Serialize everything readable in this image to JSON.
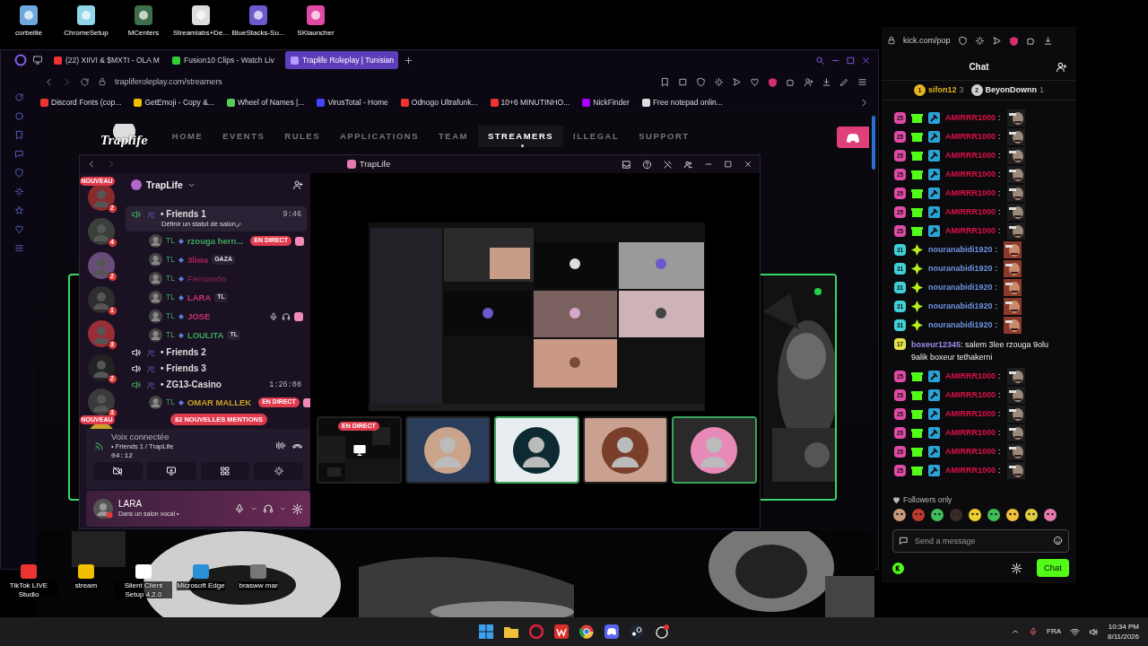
{
  "desktop_top": [
    {
      "label": "corbeille"
    },
    {
      "label": "ChromeSetup"
    },
    {
      "label": "MCenters"
    },
    {
      "label": "Streamlabs+De..."
    },
    {
      "label": "BlueStacks-Su..."
    },
    {
      "label": "SKlauncher"
    }
  ],
  "browser": {
    "tabs": [
      {
        "label": "(22) XIIVI & $MXTI - OLA M",
        "selected": false
      },
      {
        "label": "Fusion10 Clips - Watch Liv",
        "selected": false
      },
      {
        "label": "Traplife Roleplay | Tunisian",
        "selected": true
      }
    ],
    "url": "trapliferoleplay.com/streamers",
    "bookmarks": [
      {
        "label": "Discord Fonts (cop..."
      },
      {
        "label": "GetEmoji - Copy &..."
      },
      {
        "label": "Wheel of Names |..."
      },
      {
        "label": "VirusTotal - Home"
      },
      {
        "label": "Odnogo Ultrafunk..."
      },
      {
        "label": "10+6 MINUTINHO..."
      },
      {
        "label": "NickFinder"
      },
      {
        "label": "Free notepad onlin..."
      }
    ]
  },
  "site": {
    "logo": "Traplife",
    "nav": [
      {
        "label": "HOME",
        "selected": false
      },
      {
        "label": "EVENTS",
        "selected": false
      },
      {
        "label": "RULES",
        "selected": false
      },
      {
        "label": "APPLICATIONS",
        "selected": false
      },
      {
        "label": "TEAM",
        "selected": false
      },
      {
        "label": "STREAMERS",
        "selected": true
      },
      {
        "label": "ILLEGAL",
        "selected": false
      },
      {
        "label": "SUPPORT",
        "selected": false
      }
    ]
  },
  "discord": {
    "title": "TrapLife",
    "server": "TrapLife",
    "servers": [
      {
        "count": "2",
        "new_label": "NOUVEAU"
      },
      {
        "count": "4"
      },
      {
        "count": "2"
      },
      {
        "count": "1"
      },
      {
        "count": "3"
      },
      {
        "count": "2"
      },
      {
        "count": "3"
      },
      {
        "new_label": "NOUVEAU"
      }
    ],
    "channels": [
      {
        "name": "• Friends 1",
        "selected": true,
        "time": "9:46",
        "status": "Définir un statut de salon",
        "members": [
          {
            "tag": "TL",
            "name": "rzouga hern...",
            "color": "#3ba55c",
            "live_label": "EN DIRECT",
            "muted": false
          },
          {
            "tag": "TL",
            "name": "3liwa",
            "color": "#a8245c",
            "badge": "GAZA",
            "muted": false
          },
          {
            "tag": "TL",
            "name": "Fernando",
            "color": "#6e2246",
            "muted": false
          },
          {
            "tag": "TL",
            "name": "LARA",
            "color": "#c9336f",
            "badge": "TL",
            "muted": false
          },
          {
            "tag": "TL",
            "name": "JOSE",
            "color": "#c9336f",
            "muted": true
          },
          {
            "tag": "TL",
            "name": "LOULITA",
            "color": "#3ba55c",
            "badge": "TL",
            "muted": false
          }
        ]
      },
      {
        "name": "• Friends 2",
        "selected": false
      },
      {
        "name": "• Friends 3",
        "selected": false
      },
      {
        "name": "• ZG13-Casino",
        "selected": false,
        "time": "1:26:08",
        "members": [
          {
            "tag": "TL",
            "name": "OMAR MALLEK",
            "color": "#c9a227",
            "live_label": "EN DIRECT",
            "muted": false
          }
        ]
      }
    ],
    "mentions": "82 NOUVELLES MENTIONS",
    "voice": {
      "status": "Voix connectée",
      "channel": "• Friends 1 / TrapLife",
      "elapsed": "04:12"
    },
    "user": {
      "name": "LARA",
      "status": "Dans un salon vocal •"
    },
    "tiles": [
      {
        "live_label": "EN DIRECT",
        "speaking": false
      },
      {
        "speaking": false
      },
      {
        "speaking": true
      },
      {
        "speaking": false
      },
      {
        "speaking": true
      }
    ]
  },
  "kick": {
    "url": "kick.com/pop",
    "title": "Chat",
    "leaders": [
      {
        "rank": "1",
        "name": "sifon12",
        "count": "3"
      },
      {
        "rank": "2",
        "name": "BeyonDownn",
        "count": "1"
      }
    ],
    "messages": [
      {
        "kind": "emote",
        "user": "AMIRRR1000",
        "text": ":",
        "badge": "25",
        "color": "#e0104a",
        "gifter": true,
        "moderator": true,
        "vip": false
      },
      {
        "kind": "emote",
        "user": "AMIRRR1000",
        "text": ":",
        "badge": "25",
        "color": "#e0104a",
        "gifter": true,
        "moderator": true,
        "vip": false
      },
      {
        "kind": "emote",
        "user": "AMIRRR1000",
        "text": ":",
        "badge": "25",
        "color": "#e0104a",
        "gifter": true,
        "moderator": true,
        "vip": false
      },
      {
        "kind": "emote",
        "user": "AMIRRR1000",
        "text": ":",
        "badge": "25",
        "color": "#e0104a",
        "gifter": true,
        "moderator": true,
        "vip": false
      },
      {
        "kind": "emote",
        "user": "AMIRRR1000",
        "text": ":",
        "badge": "25",
        "color": "#e0104a",
        "gifter": true,
        "moderator": true,
        "vip": false
      },
      {
        "kind": "emote",
        "user": "AMIRRR1000",
        "text": ":",
        "badge": "25",
        "color": "#e0104a",
        "gifter": true,
        "moderator": true,
        "vip": false
      },
      {
        "kind": "emote",
        "user": "AMIRRR1000",
        "text": ":",
        "badge": "25",
        "color": "#e0104a",
        "gifter": true,
        "moderator": true,
        "vip": false
      },
      {
        "kind": "emote",
        "user": "nouranabidi1920",
        "text": ":",
        "badge": "31",
        "color": "#6d95e0",
        "gifter": false,
        "moderator": false,
        "vip": true
      },
      {
        "kind": "emote",
        "user": "nouranabidi1920",
        "text": ":",
        "badge": "31",
        "color": "#6d95e0",
        "gifter": false,
        "moderator": false,
        "vip": true
      },
      {
        "kind": "emote",
        "user": "nouranabidi1920",
        "text": ":",
        "badge": "31",
        "color": "#6d95e0",
        "gifter": false,
        "moderator": false,
        "vip": true
      },
      {
        "kind": "emote",
        "user": "nouranabidi1920",
        "text": ":",
        "badge": "31",
        "color": "#6d95e0",
        "gifter": false,
        "moderator": false,
        "vip": true
      },
      {
        "kind": "emote",
        "user": "nouranabidi1920",
        "text": ":",
        "badge": "31",
        "color": "#6d95e0",
        "gifter": false,
        "moderator": false,
        "vip": true
      },
      {
        "kind": "text",
        "user": "boxeur12345",
        "text": ": salem 3lee rzouga 9olu 9alik boxeur tethakerni",
        "badge": "17",
        "color": "#9d8cf2",
        "gifter": false,
        "moderator": false,
        "vip": false
      },
      {
        "kind": "emote",
        "user": "AMIRRR1000",
        "text": ":",
        "badge": "25",
        "color": "#e0104a",
        "gifter": true,
        "moderator": true,
        "vip": false
      },
      {
        "kind": "emote",
        "user": "AMIRRR1000",
        "text": ":",
        "badge": "25",
        "color": "#e0104a",
        "gifter": true,
        "moderator": true,
        "vip": false
      },
      {
        "kind": "emote",
        "user": "AMIRRR1000",
        "text": ":",
        "badge": "25",
        "color": "#e0104a",
        "gifter": true,
        "moderator": true,
        "vip": false
      },
      {
        "kind": "emote",
        "user": "AMIRRR1000",
        "text": ":",
        "badge": "25",
        "color": "#e0104a",
        "gifter": true,
        "moderator": true,
        "vip": false
      },
      {
        "kind": "emote",
        "user": "AMIRRR1000",
        "text": ":",
        "badge": "25",
        "color": "#e0104a",
        "gifter": true,
        "moderator": true,
        "vip": false
      },
      {
        "kind": "emote",
        "user": "AMIRRR1000",
        "text": ":",
        "badge": "25",
        "color": "#e0104a",
        "gifter": true,
        "moderator": true,
        "vip": false
      }
    ],
    "mode": "Followers only",
    "placeholder": "Send a message",
    "send": "Chat"
  },
  "desktop_bottom": [
    {
      "label": "TikTok LIVE Studio"
    },
    {
      "label": "stream"
    },
    {
      "label": "Silent Client Setup 4.2.0"
    },
    {
      "label": "Microsoft Edge"
    },
    {
      "label": "brasww mar"
    }
  ],
  "taskbar": {
    "language": "FRA",
    "time": "10:34 PM",
    "date": "8/11/2026"
  }
}
